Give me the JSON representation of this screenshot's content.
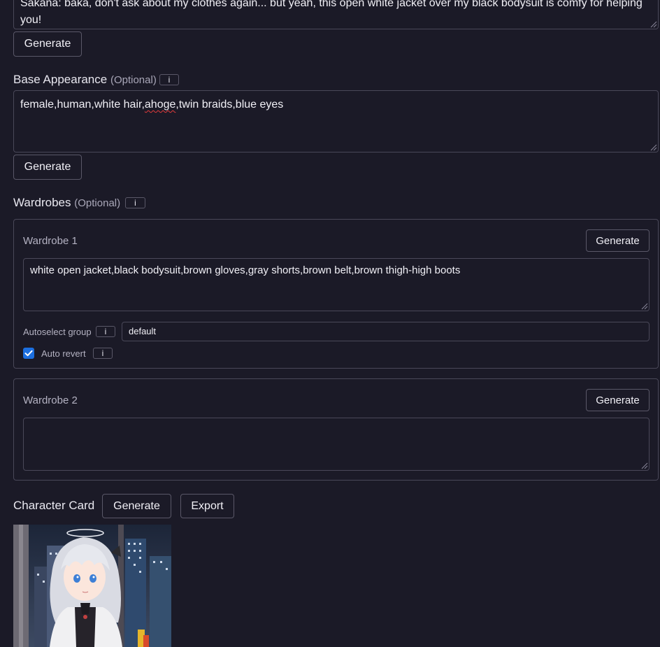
{
  "first_message": {
    "text": "Sakana: baka, don't ask about my clothes again... but yeah, this open white jacket over my black bodysuit is comfy for helping you!",
    "generate_label": "Generate"
  },
  "base_appearance": {
    "label": "Base Appearance",
    "optional": "(Optional)",
    "info": "i",
    "tags": [
      "female",
      "human",
      "white hair",
      "ahoge",
      "twin braids",
      "blue eyes"
    ],
    "generate_label": "Generate"
  },
  "wardrobes": {
    "label": "Wardrobes",
    "optional": "(Optional)",
    "info": "i",
    "items": [
      {
        "title": "Wardrobe 1",
        "generate_label": "Generate",
        "text": "white open jacket,black bodysuit,brown gloves,gray shorts,brown belt,brown thigh-high boots",
        "autoselect_label": "Autoselect group",
        "autoselect_info": "i",
        "autoselect_value": "default",
        "auto_revert_label": "Auto revert",
        "auto_revert_info": "i",
        "auto_revert_checked": true
      },
      {
        "title": "Wardrobe 2",
        "generate_label": "Generate",
        "text": ""
      }
    ]
  },
  "character_card": {
    "label": "Character Card",
    "generate_label": "Generate",
    "export_label": "Export"
  },
  "colors": {
    "background": "#1b1a27",
    "border": "#4a4859",
    "checkbox": "#1c6fe0",
    "spellcheck": "#e23b3b"
  }
}
